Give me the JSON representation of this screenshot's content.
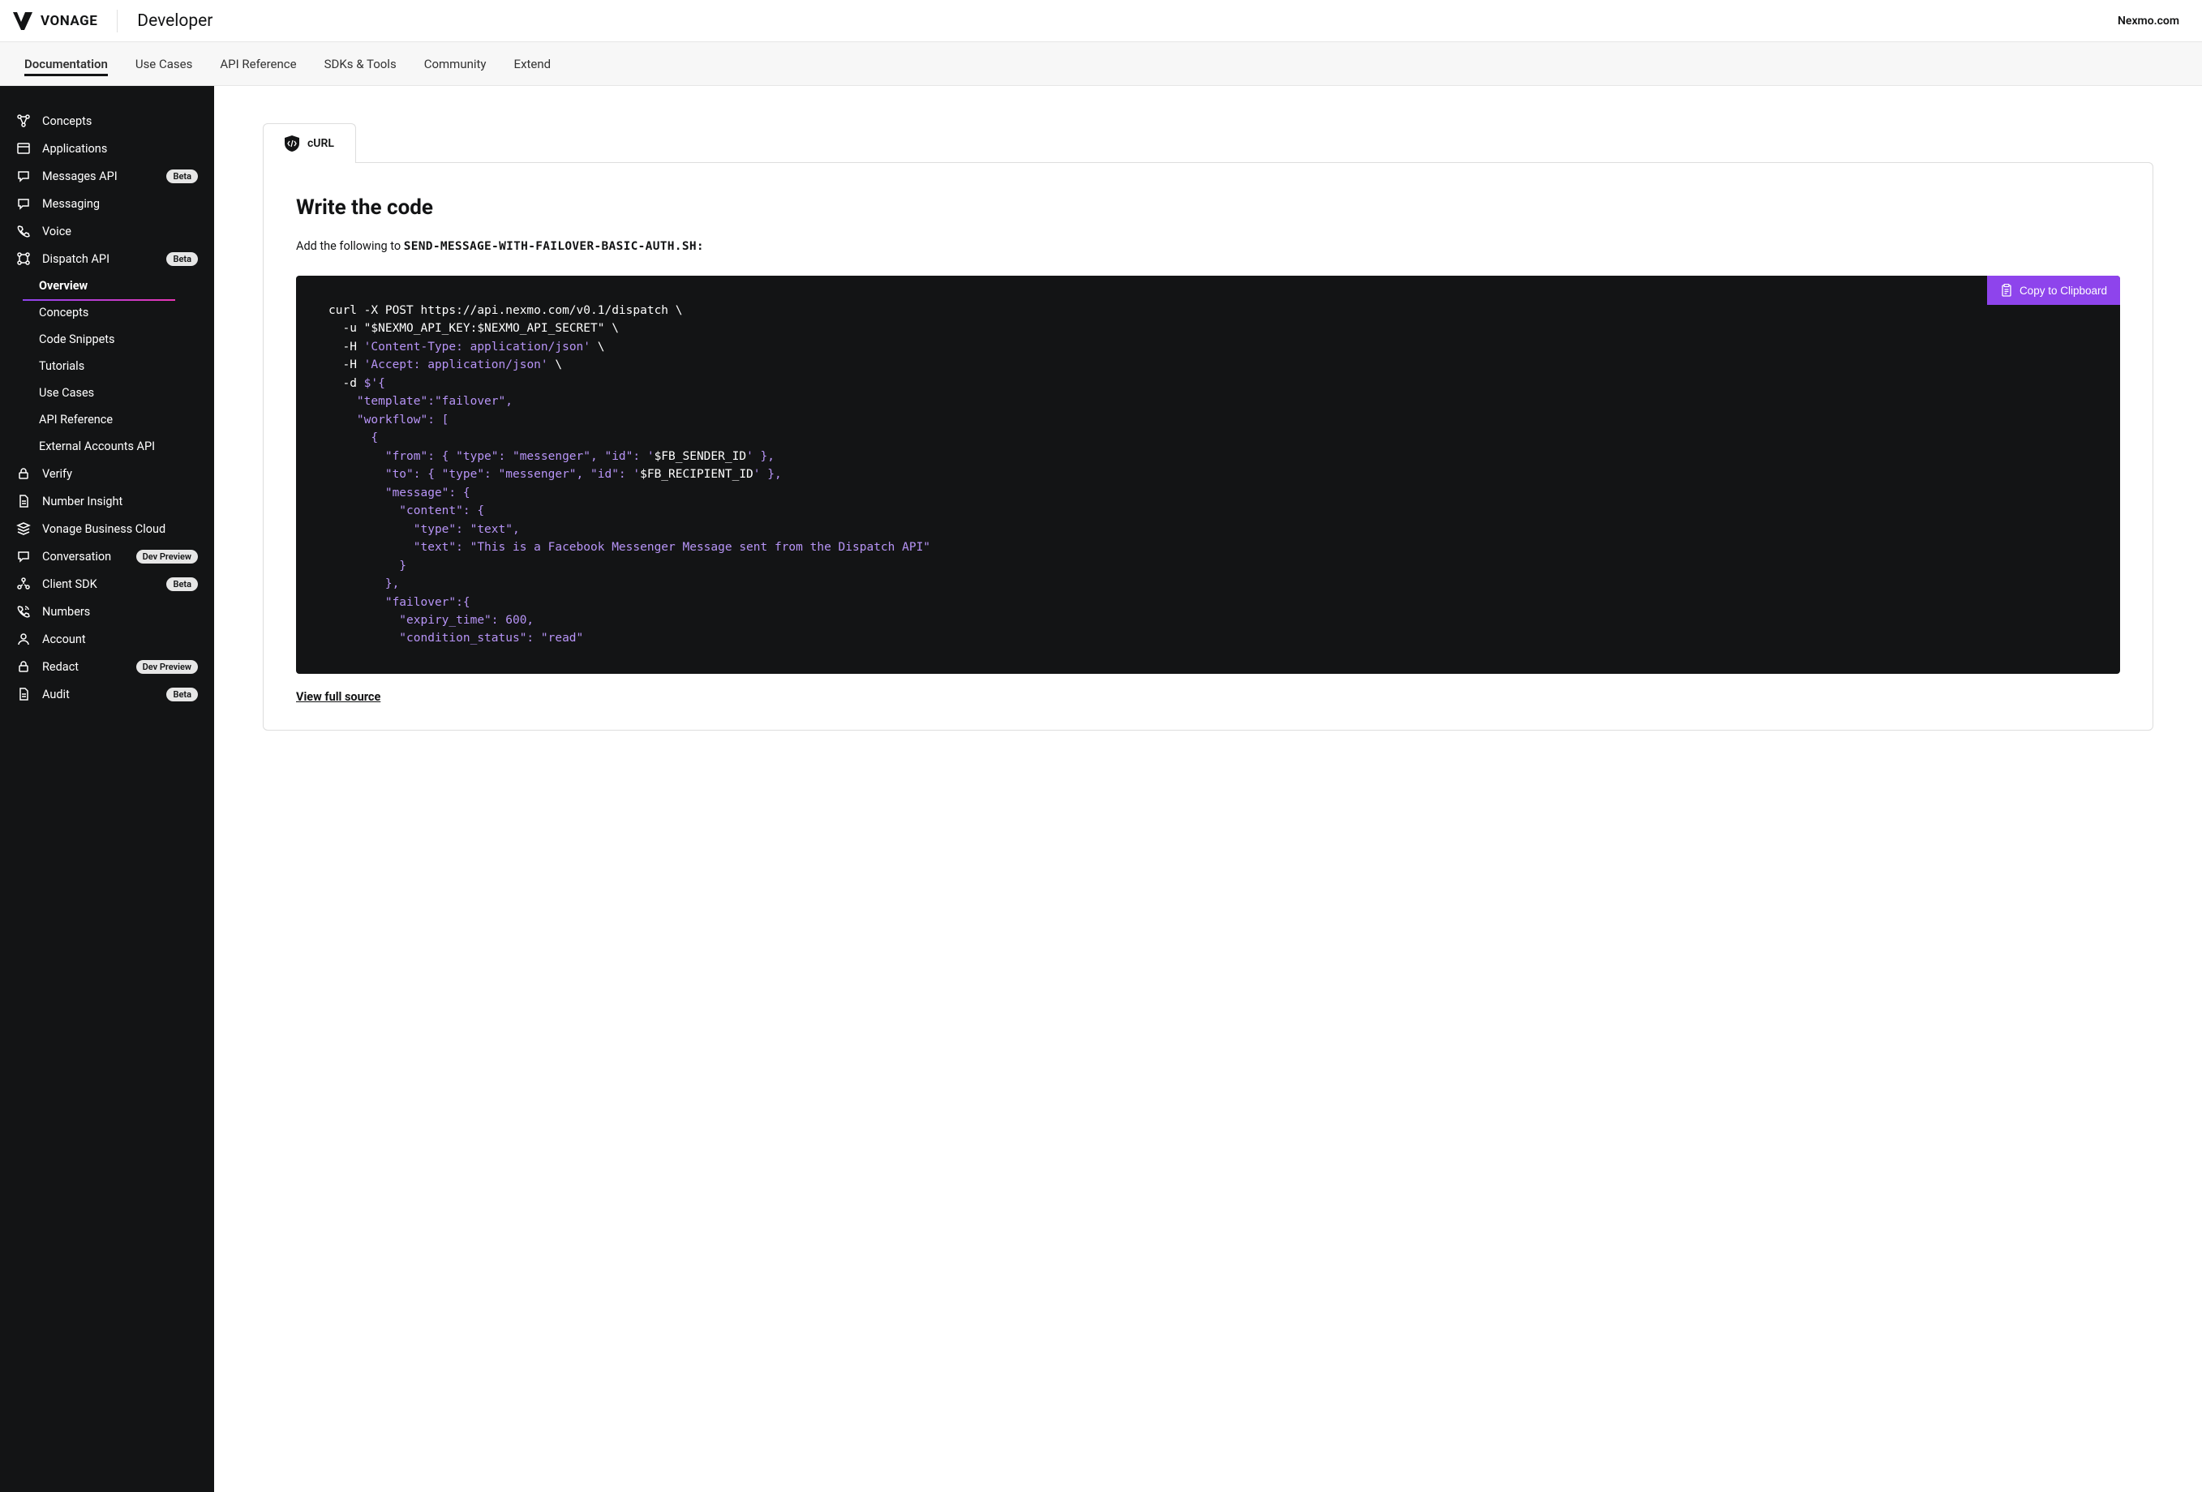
{
  "header": {
    "brand": "VONAGE",
    "app": "Developer",
    "right_link": "Nexmo.com"
  },
  "tabs": [
    "Documentation",
    "Use Cases",
    "API Reference",
    "SDKs & Tools",
    "Community",
    "Extend"
  ],
  "badges": {
    "beta": "Beta",
    "dev_preview": "Dev Preview"
  },
  "sidebar": {
    "items": [
      {
        "label": "Concepts",
        "icon": "nodes"
      },
      {
        "label": "Applications",
        "icon": "window"
      },
      {
        "label": "Messages API",
        "icon": "chat",
        "badge": "beta"
      },
      {
        "label": "Messaging",
        "icon": "chat"
      },
      {
        "label": "Voice",
        "icon": "phone"
      },
      {
        "label": "Dispatch API",
        "icon": "flow",
        "badge": "beta",
        "expanded": true
      },
      {
        "label": "Verify",
        "icon": "lock"
      },
      {
        "label": "Number Insight",
        "icon": "doc"
      },
      {
        "label": "Vonage Business Cloud",
        "icon": "stack"
      },
      {
        "label": "Conversation",
        "icon": "chat",
        "badge": "dev_preview"
      },
      {
        "label": "Client SDK",
        "icon": "network",
        "badge": "beta"
      },
      {
        "label": "Numbers",
        "icon": "dial"
      },
      {
        "label": "Account",
        "icon": "user"
      },
      {
        "label": "Redact",
        "icon": "lock",
        "badge": "dev_preview"
      },
      {
        "label": "Audit",
        "icon": "doc",
        "badge": "beta"
      }
    ],
    "sub_items": [
      "Overview",
      "Concepts",
      "Code Snippets",
      "Tutorials",
      "Use Cases",
      "API Reference",
      "External Accounts API"
    ]
  },
  "content": {
    "tab_label": "cURL",
    "heading": "Write the code",
    "desc_prefix": "Add the following to ",
    "desc_file": "SEND-MESSAGE-WITH-FAILOVER-BASIC-AUTH.SH:",
    "copy_label": "Copy to Clipboard",
    "view_source": "View full source",
    "code": {
      "l1": "curl -X POST https://api.nexmo.com/v0.1/dispatch \\",
      "l2a": "  -u ",
      "l2b": "\"$NEXMO_API_KEY:$NEXMO_API_SECRET\"",
      "l2c": " \\",
      "l3a": "  -H ",
      "l3b": "'Content-Type: application/json'",
      "l3c": " \\",
      "l4a": "  -H ",
      "l4b": "'Accept: application/json'",
      "l4c": " \\",
      "l5a": "  -d ",
      "l5b": "$'{",
      "l6": "    \"template\":\"failover\",",
      "l7": "    \"workflow\": [",
      "l8": "      {",
      "l9a": "        \"from\": { \"type\": \"messenger\", \"id\": '",
      "l9b": "$FB_SENDER_ID",
      "l9c": "' },",
      "l10a": "        \"to\": { \"type\": \"messenger\", \"id\": '",
      "l10b": "$FB_RECIPIENT_ID",
      "l10c": "' },",
      "l11": "        \"message\": {",
      "l12": "          \"content\": {",
      "l13": "            \"type\": \"text\",",
      "l14": "            \"text\": \"This is a Facebook Messenger Message sent from the Dispatch API\"",
      "l15": "          }",
      "l16": "        },",
      "l17": "        \"failover\":{",
      "l18": "          \"expiry_time\": 600,",
      "l19": "          \"condition_status\": \"read\""
    }
  }
}
